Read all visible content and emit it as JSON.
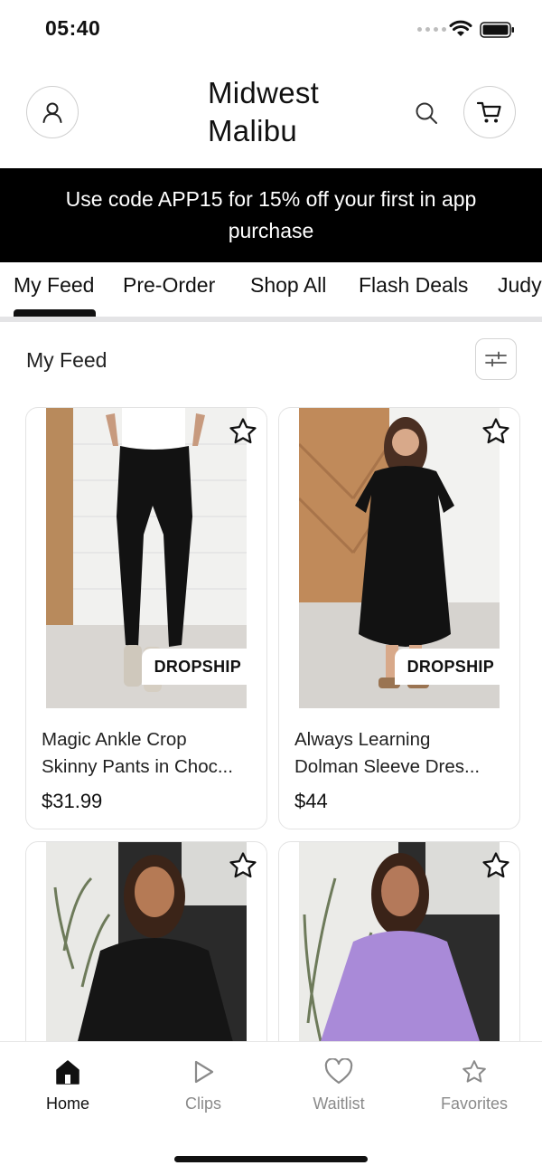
{
  "status": {
    "time": "05:40"
  },
  "header": {
    "brand_line1": "Midwest",
    "brand_line2": "Malibu"
  },
  "promo": {
    "text": "Use code APP15 for 15% off your first in app purchase"
  },
  "tabs": [
    {
      "label": "My Feed",
      "active": true
    },
    {
      "label": "Pre-Order"
    },
    {
      "label": "Shop All"
    },
    {
      "label": "Flash Deals"
    },
    {
      "label": "Judy"
    }
  ],
  "feed": {
    "title": "My Feed",
    "products": [
      {
        "title_line1": "Magic Ankle Crop",
        "title_line2": "Skinny Pants in Choc...",
        "price": "$31.99",
        "badge": "DROPSHIP"
      },
      {
        "title_line1": "Always Learning",
        "title_line2": "Dolman Sleeve Dres...",
        "price": "$44",
        "badge": "DROPSHIP"
      },
      {
        "title_line1": "",
        "title_line2": "",
        "price": "",
        "badge": ""
      },
      {
        "title_line1": "",
        "title_line2": "",
        "price": "",
        "badge": ""
      }
    ]
  },
  "bottom_nav": [
    {
      "label": "Home",
      "icon": "home-icon",
      "active": true
    },
    {
      "label": "Clips",
      "icon": "play-icon"
    },
    {
      "label": "Waitlist",
      "icon": "heart-icon"
    },
    {
      "label": "Favorites",
      "icon": "star-icon"
    }
  ],
  "colors": {
    "promo_bg": "#000000",
    "active_text": "#111111",
    "inactive_text": "#8a8a8a"
  }
}
